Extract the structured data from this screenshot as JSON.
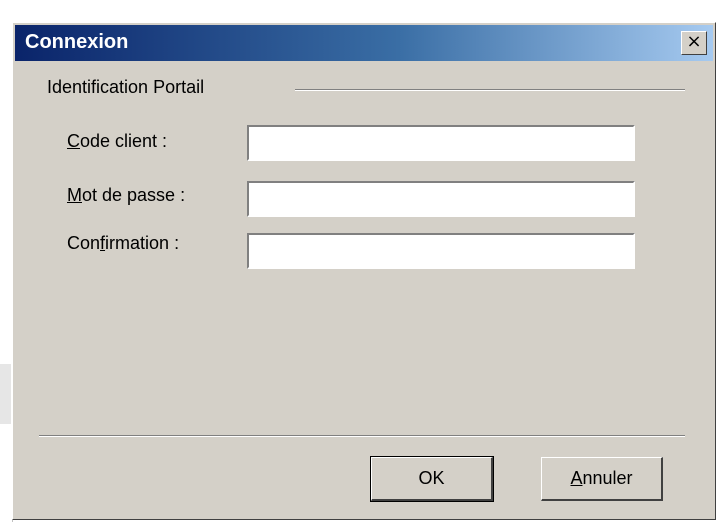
{
  "dialog": {
    "title": "Connexion",
    "close_glyph": "×",
    "group_title": "Identification Portail",
    "fields": [
      {
        "label_prefix": "",
        "label_mnemonic": "C",
        "label_rest": "ode client :",
        "value": ""
      },
      {
        "label_prefix": "",
        "label_mnemonic": "M",
        "label_rest": "ot de passe :",
        "value": ""
      },
      {
        "label_prefix": "Con",
        "label_mnemonic": "f",
        "label_rest": "irmation :",
        "value": ""
      }
    ],
    "ok_label": "OK",
    "cancel_prefix": "",
    "cancel_mnemonic": "A",
    "cancel_rest": "nnuler"
  },
  "colors": {
    "titlebar_start": "#0a246a",
    "titlebar_end": "#a6caf0",
    "dialog_face": "#d4d0c8"
  },
  "icons": {
    "close": "close-icon"
  }
}
